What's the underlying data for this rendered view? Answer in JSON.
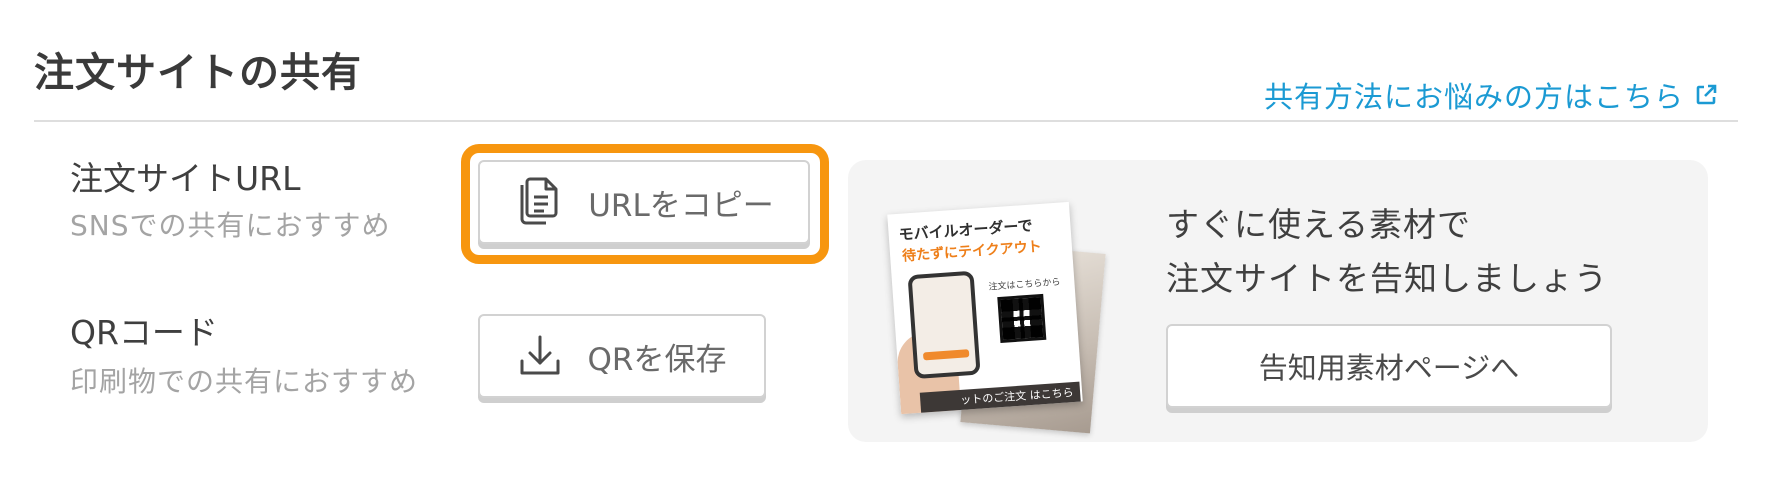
{
  "section": {
    "title": "注文サイトの共有",
    "help_link": "共有方法にお悩みの方はこちら"
  },
  "url_row": {
    "label": "注文サイトURL",
    "sub": "SNSでの共有におすすめ",
    "button": "URLをコピー",
    "button_icon": "copy-document-icon"
  },
  "qr_row": {
    "label": "QRコード",
    "sub": "印刷物での共有におすすめ",
    "button": "QRを保存",
    "button_icon": "download-icon"
  },
  "promo": {
    "line1": "すぐに使える素材で",
    "line2": "注文サイトを告知しましょう",
    "button": "告知用素材ページへ",
    "flyer_title": "モバイルオーダーで",
    "flyer_sub": "待たずにテイクアウト",
    "flyer_qr_label": "注文はこちらから",
    "flyer_bottom": "ットのご注文 はこちら"
  },
  "colors": {
    "accent_link": "#1b9ad3",
    "highlight": "#f7960f",
    "promo_bg": "#f4f4f4"
  }
}
